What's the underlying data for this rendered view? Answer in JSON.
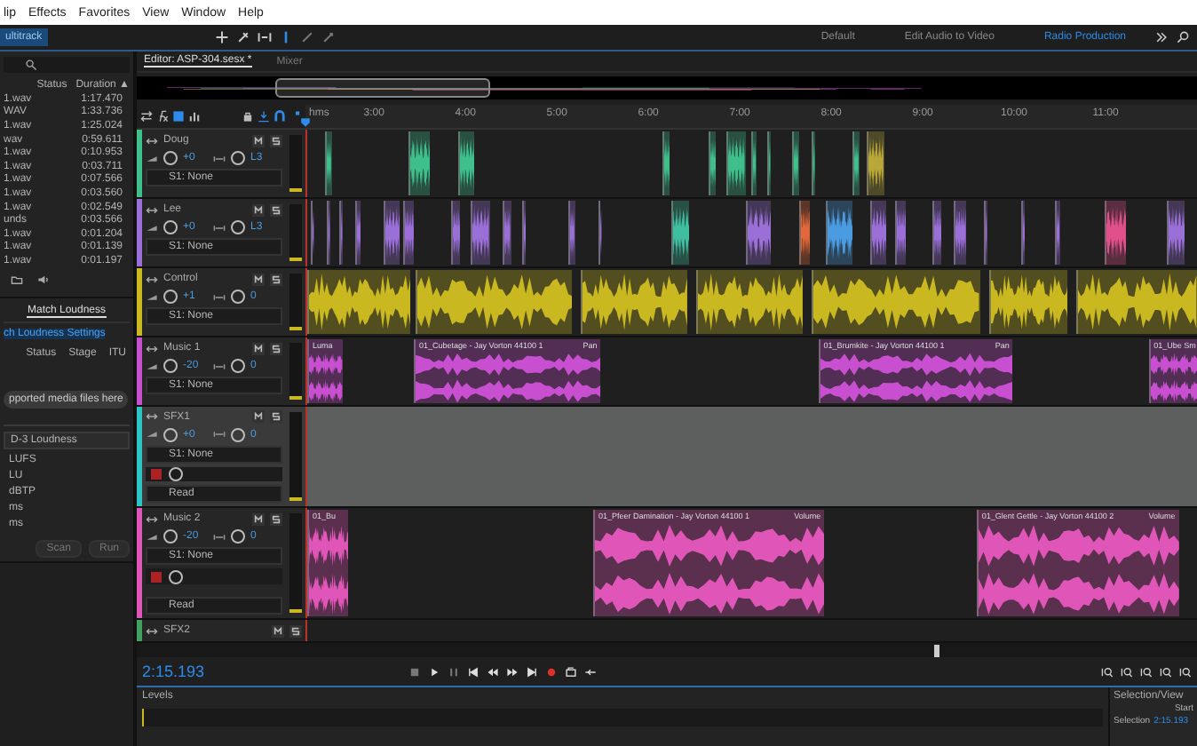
{
  "menu": [
    "lip",
    "Effects",
    "Favorites",
    "View",
    "Window",
    "Help"
  ],
  "toolbar": {
    "mode": "ultitrack",
    "workspaces": [
      {
        "label": "Default",
        "selected": false
      },
      {
        "label": "Edit Audio to Video",
        "selected": false
      },
      {
        "label": "Radio Production",
        "selected": true
      }
    ]
  },
  "files": {
    "columns": [
      "Status",
      "Duration ▲"
    ],
    "rows": [
      {
        "name": "1.wav",
        "duration": "1:17.470"
      },
      {
        "name": "WAV",
        "duration": "1:33.736"
      },
      {
        "name": "1.wav",
        "duration": "1:25.024"
      },
      {
        "name": "wav",
        "duration": "0:59.611"
      },
      {
        "name": "1.wav",
        "duration": "0:10.953"
      },
      {
        "name": "1.wav",
        "duration": "0:03.711"
      },
      {
        "name": "1.wav",
        "duration": "0:07.566"
      },
      {
        "name": "1.wav",
        "duration": "0:03.560"
      },
      {
        "name": "1.wav",
        "duration": "0:02.549"
      },
      {
        "name": "unds",
        "duration": "0:03.566"
      },
      {
        "name": "1.wav",
        "duration": "0:01.204"
      },
      {
        "name": "1.wav",
        "duration": "0:01.139"
      },
      {
        "name": "1.wav",
        "duration": "0:01.197"
      }
    ]
  },
  "match_loudness": {
    "tab": "Match Loudness",
    "settings_link": "ch Loudness Settings",
    "columns": [
      "Status",
      "Stage",
      "ITU"
    ],
    "drop_button": "pported media files here",
    "preset": "D-3 Loudness",
    "fields": [
      "LUFS",
      "LU",
      "dBTP",
      "ms",
      "ms"
    ],
    "buttons": [
      "Scan",
      "Run"
    ]
  },
  "editor": {
    "tabs": [
      {
        "label": "Editor: ASP-304.sesx *",
        "selected": true
      },
      {
        "label": "Mixer",
        "selected": false
      }
    ],
    "ruler": [
      "hms",
      "3:00",
      "4:00",
      "5:00",
      "6:00",
      "7:00",
      "8:00",
      "9:00",
      "10:00",
      "11:00"
    ],
    "tracks": [
      {
        "name": "Doug",
        "kind": "basic",
        "color": "#3fbf8c",
        "selected": false,
        "volume": "+0",
        "pan": "L3",
        "effect": "S1: None"
      },
      {
        "name": "Lee",
        "kind": "basic",
        "color": "#9a6fd8",
        "selected": false,
        "volume": "+0",
        "pan": "L3",
        "effect": "S1: None"
      },
      {
        "name": "Control",
        "kind": "basic",
        "color": "#c9b820",
        "selected": false,
        "volume": "+1",
        "pan": "0",
        "effect": "S1: None"
      },
      {
        "name": "Music 1",
        "kind": "basic",
        "color": "#c84fd0",
        "selected": false,
        "volume": "-20",
        "pan": "0",
        "effect": "S1: None",
        "clips": [
          {
            "name": "Luma"
          },
          {
            "name": "01_Cubetage - Jay Vorton 44100 1",
            "envelope": "Pan"
          },
          {
            "name": "01_Brumkite - Jay Vorton 44100 1",
            "envelope": "Pan"
          },
          {
            "name": "01_Ube Sm"
          }
        ]
      },
      {
        "name": "SFX1",
        "kind": "automation",
        "color": "#2fc4c4",
        "selected": true,
        "volume": "+0",
        "pan": "0",
        "effect": "S1: None",
        "automation": "Read"
      },
      {
        "name": "Music 2",
        "kind": "automation",
        "color": "#e055b8",
        "selected": false,
        "volume": "-20",
        "pan": "0",
        "effect": "S1: None",
        "automation": "Read",
        "clips": [
          {
            "name": "01_Bu"
          },
          {
            "name": "01_Pfeer Damination - Jay Vorton 44100 1",
            "envelope": "Volume"
          },
          {
            "name": "01_Glent Gettle - Jay Vorton 44100 2",
            "envelope": "Volume"
          }
        ]
      },
      {
        "name": "SFX2",
        "kind": "collapsed",
        "color": "#3fa060",
        "selected": false
      }
    ]
  },
  "transport": {
    "time": "2:15.193"
  },
  "levels": {
    "title": "Levels"
  },
  "selection_view": {
    "title": "Selection/View",
    "column": "Start",
    "row_label": "Selection",
    "value": "2:15.193"
  }
}
